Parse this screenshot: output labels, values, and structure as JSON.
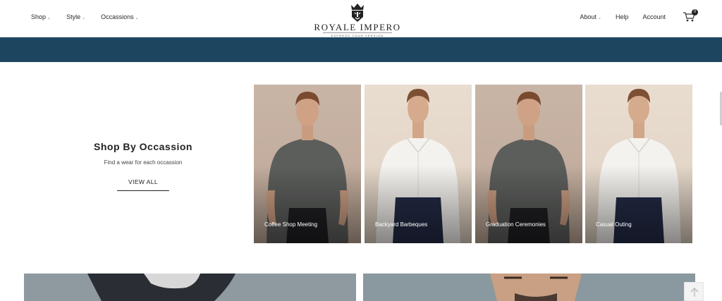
{
  "header": {
    "nav_left": [
      "Shop",
      "Style",
      "Occassions"
    ],
    "nav_right": [
      "About",
      "Help",
      "Account"
    ],
    "cart_count": "0",
    "logo_name": "ROYALE IMPERO",
    "logo_tagline": "EXPRESS YOUR VERSION"
  },
  "colors": {
    "banner": "#1d4560",
    "text": "#222222",
    "card_label": "#ffffff"
  },
  "occasions": {
    "title": "Shop By Occassion",
    "subtitle": "Find a wear for each occassion",
    "cta": "VIEW ALL",
    "cards": [
      {
        "label": "Coffee Shop Meeting",
        "outfit": "grey t-shirt"
      },
      {
        "label": "Backyard Barbeques",
        "outfit": "white shirt"
      },
      {
        "label": "Graduation Ceremonies",
        "outfit": "grey t-shirt"
      },
      {
        "label": "Casual Outing",
        "outfit": "white shirt"
      }
    ]
  },
  "icons": {
    "cart": "cart-icon",
    "logo": "crown-lion-icon",
    "chevron": "chevron-down-icon",
    "back_to_top": "arrow-up-icon"
  }
}
